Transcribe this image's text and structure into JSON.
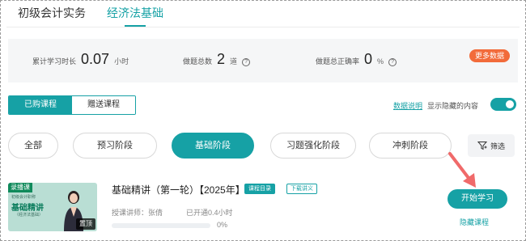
{
  "subject_tabs": [
    {
      "label": "初级会计实务",
      "active": false
    },
    {
      "label": "经济法基础",
      "active": true
    }
  ],
  "stats": {
    "study_time_label": "累计学习时长",
    "study_time_value": "0.07",
    "study_time_unit": "小时",
    "total_questions_label": "做题总数",
    "total_questions_value": "2",
    "total_questions_unit": "道",
    "accuracy_label": "做题总正确率",
    "accuracy_value": "0",
    "accuracy_unit": "%",
    "more_data_label": "更多数据",
    "accent_color": "#f26b3a"
  },
  "purchase_tabs": [
    {
      "label": "已购课程",
      "active": true
    },
    {
      "label": "赠送课程",
      "active": false
    }
  ],
  "options": {
    "data_explain_label": "数据说明",
    "show_hidden_label": "显示隐藏的内容",
    "show_hidden_on": true
  },
  "stages": [
    {
      "label": "全部",
      "active": false
    },
    {
      "label": "预习阶段",
      "active": false
    },
    {
      "label": "基础阶段",
      "active": true
    },
    {
      "label": "习题强化阶段",
      "active": false
    },
    {
      "label": "冲刺阶段",
      "active": false
    }
  ],
  "filter_label": "筛选",
  "course": {
    "thumbnail": {
      "badge": "录播课",
      "line1": "初级会计职称",
      "title": "基础精讲",
      "line2": "（经济法基础）",
      "pin_label": "置顶"
    },
    "title": "基础精讲（第一轮）【2025年】",
    "tag_catalog": "课程目录",
    "tag_handout": "下载讲义",
    "teacher": "授课讲师：张倩",
    "opened": "已开通0.4小时",
    "progress_percent": 0,
    "progress_label": "0%",
    "start_label": "开始学习",
    "hide_label": "隐藏课程"
  },
  "colors": {
    "brand": "#16a1a5",
    "annotation_arrow": "#f06a6a"
  }
}
